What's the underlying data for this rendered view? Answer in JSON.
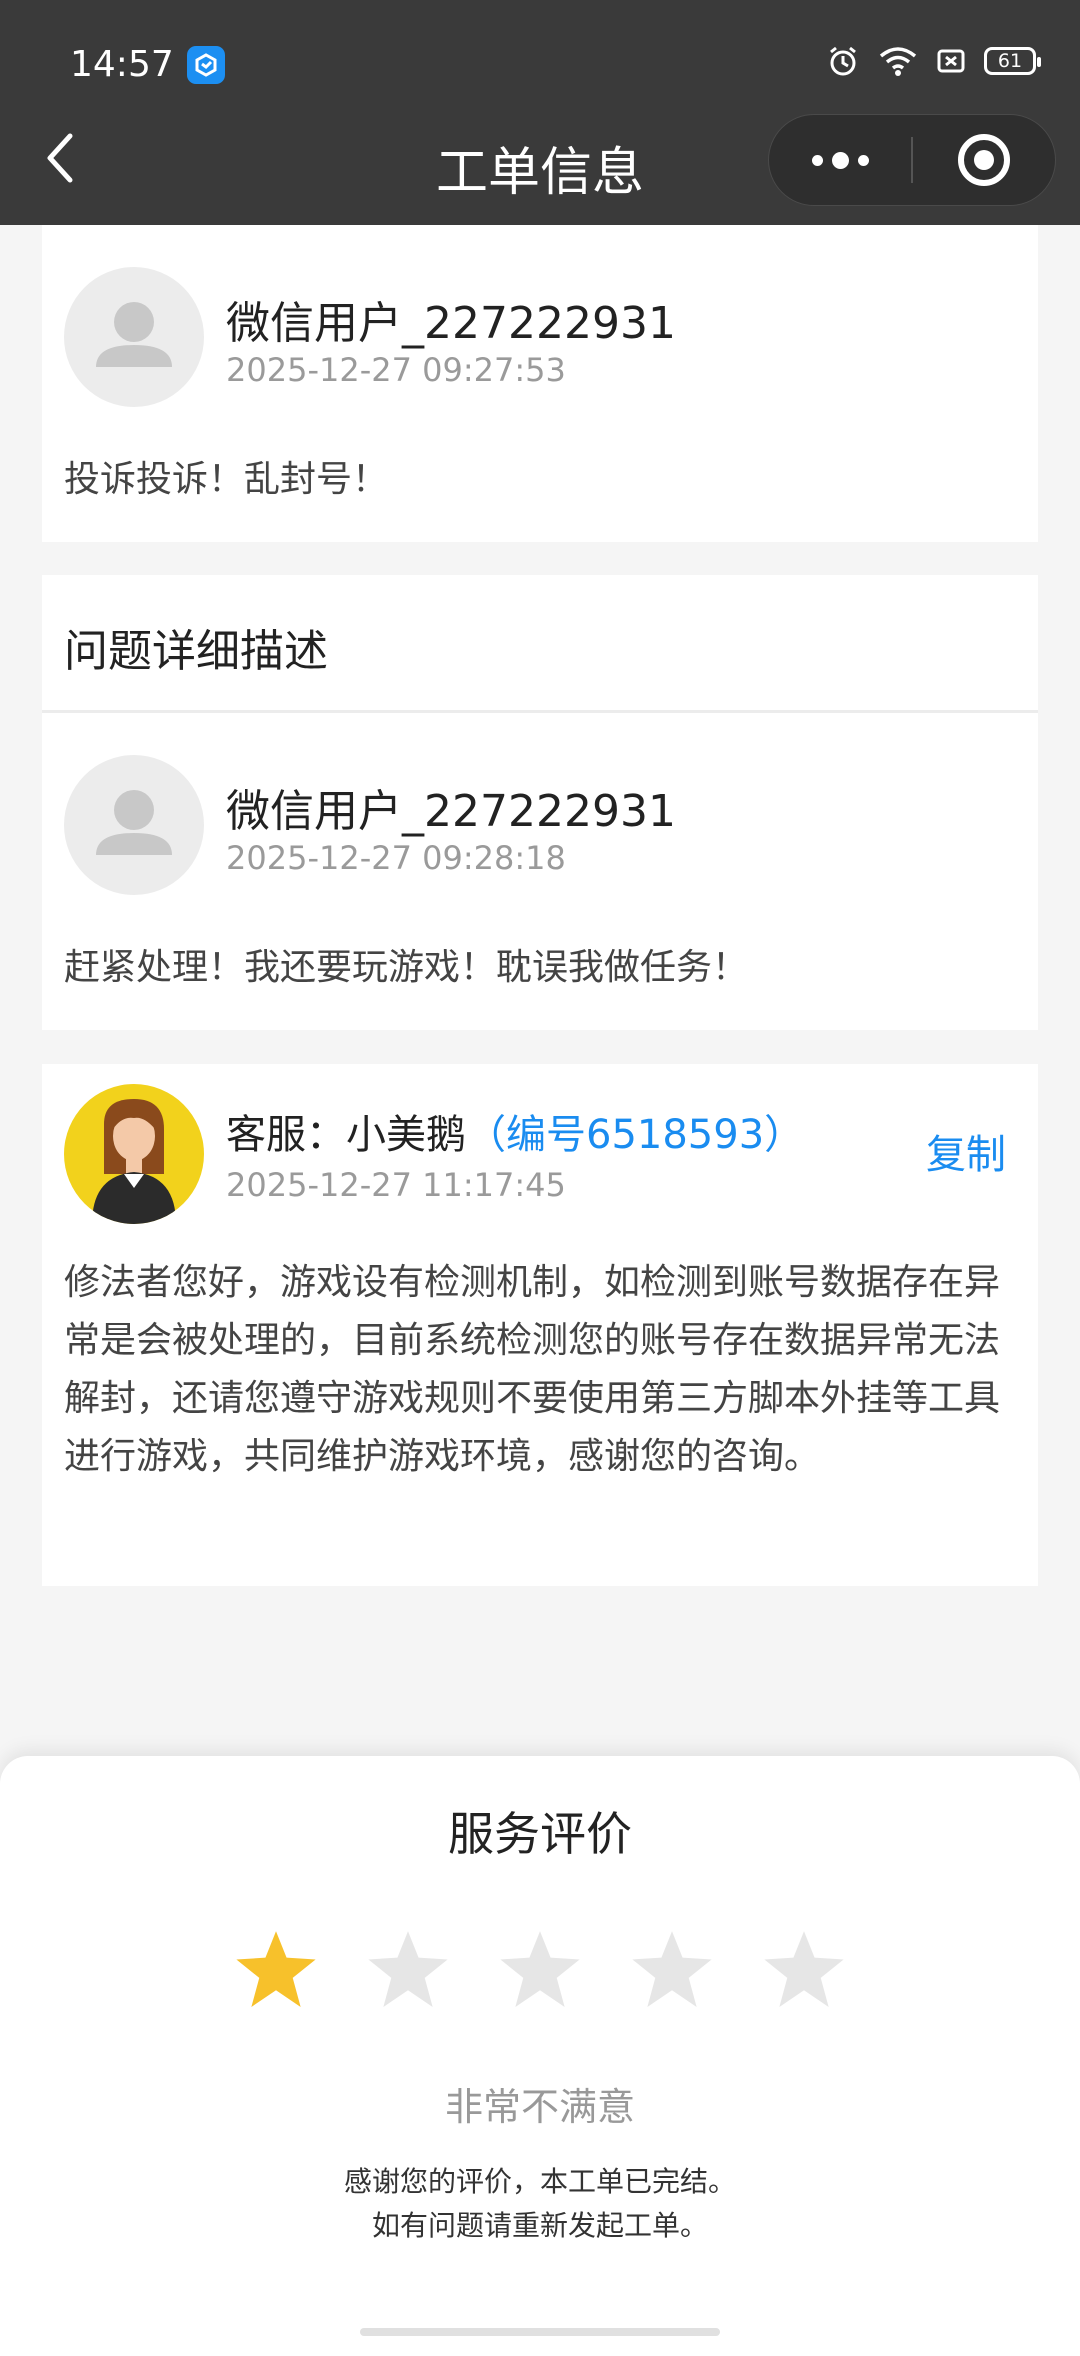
{
  "status_bar": {
    "time": "14:57",
    "battery": "61"
  },
  "nav": {
    "title": "工单信息"
  },
  "messages": [
    {
      "username": "微信用户_227222931",
      "time": "2025-12-27 09:27:53",
      "text": "投诉投诉！乱封号！"
    },
    {
      "username": "微信用户_227222931",
      "time": "2025-12-27 09:28:18",
      "text": "赶紧处理！我还要玩游戏！耽误我做任务！"
    }
  ],
  "section_title": "问题详细描述",
  "agent": {
    "label": "客服：小美鹅",
    "id_text": "（编号6518593）",
    "time": "2025-12-27 11:17:45",
    "copy_label": "复制",
    "text": "修法者您好，游戏设有检测机制，如检测到账号数据存在异常是会被处理的，目前系统检测您的账号存在数据异常无法解封，还请您遵守游戏规则不要使用第三方脚本外挂等工具进行游戏，共同维护游戏环境，感谢您的咨询。"
  },
  "rating": {
    "title": "服务评价",
    "stars_total": 5,
    "stars_selected": 1,
    "active_color": "#f7c12b",
    "inactive_color": "#e6e6e6",
    "result_text": "非常不满意",
    "thanks_line1": "感谢您的评价，本工单已完结。",
    "thanks_line2": "如有问题请重新发起工单。"
  }
}
